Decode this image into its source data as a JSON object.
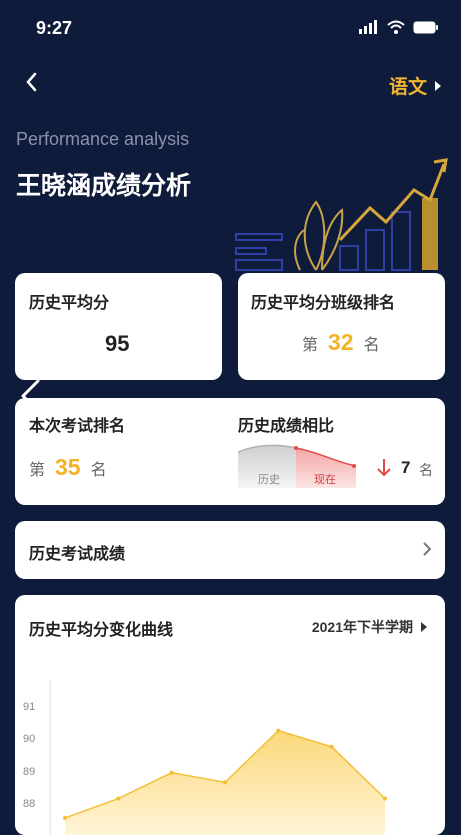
{
  "status_bar": {
    "time": "9:27"
  },
  "header": {
    "subject": "语文",
    "subtitle": "Performance analysis",
    "title": "王晓涵成绩分析"
  },
  "avg_card": {
    "label": "历史平均分",
    "value": "95"
  },
  "class_rank_card": {
    "label": "历史平均分班级排名",
    "prefix": "第",
    "rank": "32",
    "suffix": "名"
  },
  "exam_card": {
    "rank_label": "本次考试排名",
    "prefix": "第",
    "rank": "35",
    "suffix": "名",
    "compare_label": "历史成绩相比",
    "history_tag": "历史",
    "now_tag": "现在",
    "change_value": "7",
    "change_unit": "名",
    "change_direction": "down"
  },
  "history_exams": {
    "label": "历史考试成绩"
  },
  "trend_card": {
    "title": "历史平均分变化曲线",
    "term": "2021年下半学期",
    "y_ticks": [
      "91",
      "90",
      "89",
      "88"
    ]
  },
  "chart_data": {
    "type": "area",
    "y_ticks": [
      88,
      89,
      90,
      91
    ],
    "ylim": [
      87.7,
      91.5
    ],
    "values": [
      87.6,
      88.2,
      89.0,
      88.7,
      90.3,
      89.8,
      88.2
    ]
  }
}
